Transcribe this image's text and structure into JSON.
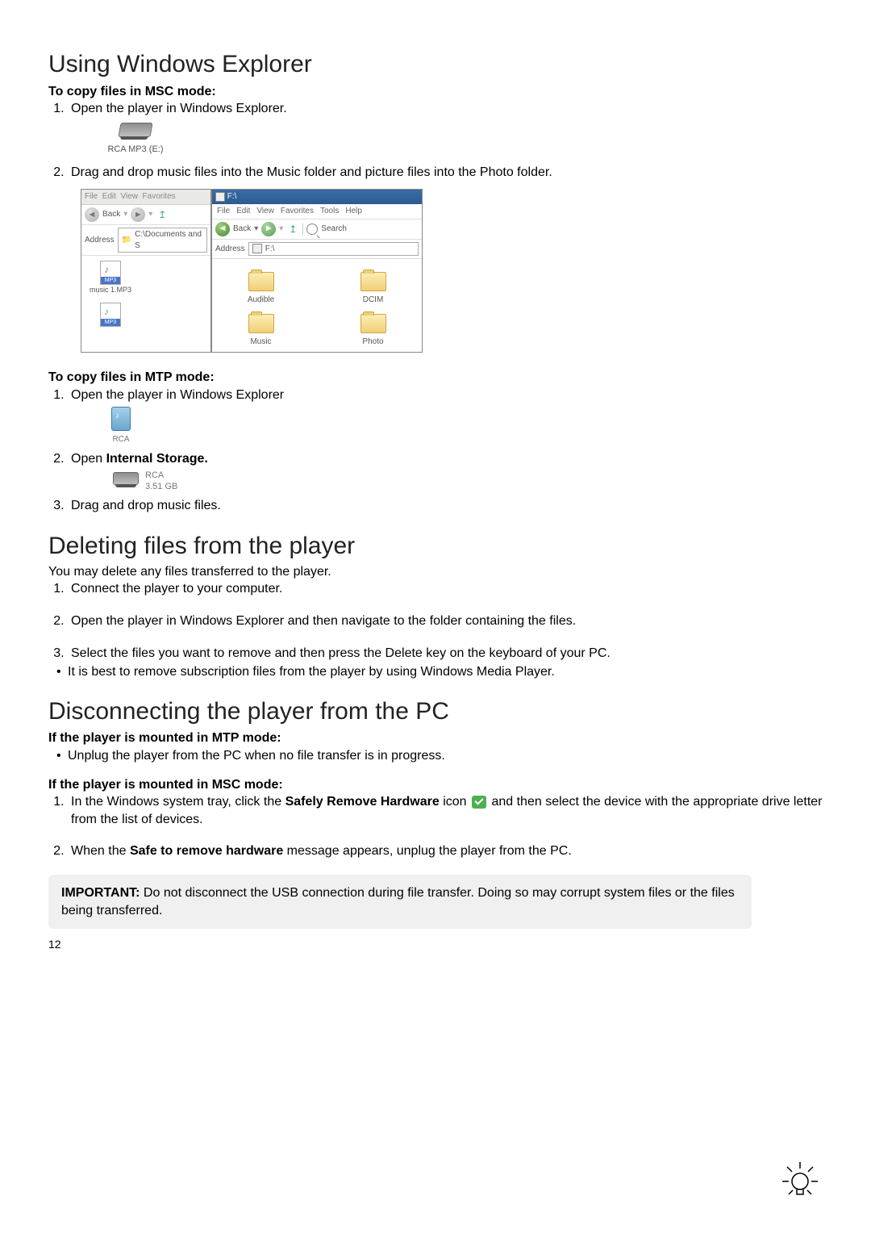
{
  "sections": {
    "usingExplorer": {
      "title": "Using Windows Explorer",
      "msc": {
        "heading": "To copy files in MSC mode:",
        "step1": "Open the player in Windows Explorer.",
        "driveLabel": "RCA MP3 (E:)",
        "step2": "Drag and drop music files into the Music folder and picture files into the Photo folder."
      },
      "xpLeft": {
        "menu": [
          "File",
          "Edit",
          "View",
          "Favorites"
        ],
        "back": "Back",
        "addressLabel": "Address",
        "addressValue": "C:\\Documents and S",
        "fileExt": "MP3",
        "fileName": "music 1.MP3"
      },
      "xpRight": {
        "title": "F:\\",
        "menu": [
          "File",
          "Edit",
          "View",
          "Favorites",
          "Tools",
          "Help"
        ],
        "back": "Back",
        "search": "Search",
        "addressLabel": "Address",
        "addressValue": "F:\\",
        "folders": [
          "Audible",
          "DCIM",
          "Music",
          "Photo"
        ]
      },
      "mtp": {
        "heading": "To copy files in MTP mode:",
        "step1": "Open the player in Windows Explorer",
        "deviceLabel": "RCA",
        "step2_prefix": "Open ",
        "step2_bold": "Internal Storage.",
        "storageLabel": "RCA",
        "storageSize": "3.51 GB",
        "step3": "Drag and drop music files."
      }
    },
    "deleting": {
      "title": "Deleting files from the player",
      "intro": "You may delete any files transferred to the player.",
      "steps": [
        "Connect the player to your computer.",
        "Open the player in Windows Explorer and then navigate to the folder containing the files.",
        "Select the files you want to remove and then press the Delete key on the keyboard of your PC."
      ],
      "bullet": "It is best to remove subscription files from the player by using Windows Media Player."
    },
    "disconnecting": {
      "title": "Disconnecting the player from the PC",
      "mtpHeading": "If the player is mounted in MTP mode:",
      "mtpBullet": "Unplug the player from the PC when no file transfer is in progress.",
      "mscHeading": "If the player is mounted in MSC mode:",
      "step1_a": "In the Windows system tray, click the ",
      "step1_bold": "Safely Remove Hardware",
      "step1_b": " icon ",
      "step1_c": " and then select the device with the appropriate drive letter from the list of devices.",
      "step2_a": "When the ",
      "step2_bold": "Safe to remove hardware",
      "step2_b": " message appears, unplug the player from the PC.",
      "important_label": "IMPORTANT:",
      "important_text": " Do not disconnect the USB connection during file transfer. Doing so may corrupt system files or the files being transferred."
    }
  },
  "pageNumber": "12"
}
